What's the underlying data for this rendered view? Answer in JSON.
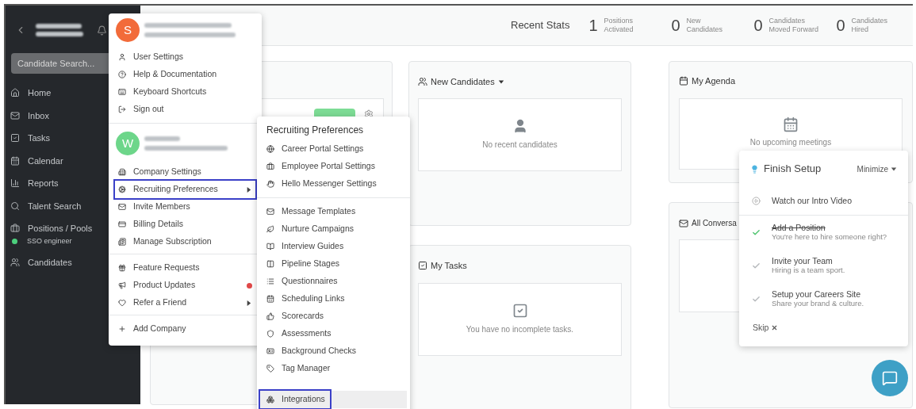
{
  "sidebar": {
    "search": {
      "placeholder": "Candidate Search..."
    },
    "items": [
      {
        "label": "Home"
      },
      {
        "label": "Inbox"
      },
      {
        "label": "Tasks"
      },
      {
        "label": "Calendar"
      },
      {
        "label": "Reports"
      },
      {
        "label": "Talent Search"
      },
      {
        "label": "Positions / Pools",
        "children": [
          {
            "label": "SSO engineer",
            "color": "#4cd07d"
          }
        ]
      },
      {
        "label": "Candidates"
      }
    ]
  },
  "header": {
    "title": "Recent Stats",
    "stats": [
      {
        "value": "1",
        "label": [
          "Positions",
          "Activated"
        ]
      },
      {
        "value": "0",
        "label": [
          "New",
          "Candidates"
        ]
      },
      {
        "value": "0",
        "label": [
          "Candidates",
          "Moved Forward"
        ]
      },
      {
        "value": "0",
        "label": [
          "Candidates",
          "Hired"
        ]
      }
    ]
  },
  "cards": {
    "new_candidates": {
      "title": "New Candidates",
      "empty_text": "No recent candidates"
    },
    "agenda": {
      "title": "My Agenda",
      "empty_text": "No upcoming meetings"
    },
    "tasks": {
      "title": "My Tasks",
      "empty_text": "You have no incomplete tasks."
    },
    "conversations": {
      "title": "All Conversa"
    }
  },
  "account_menu": {
    "user_avatar": {
      "letter": "S",
      "color": "#f26b3a"
    },
    "company_avatar": {
      "letter": "W",
      "color": "#6dd68a"
    },
    "groups": [
      [
        {
          "label": "User Settings",
          "submenu": false,
          "highlighted": false,
          "notification": false
        },
        {
          "label": "Help & Documentation",
          "submenu": false,
          "highlighted": false,
          "notification": false
        },
        {
          "label": "Keyboard Shortcuts",
          "submenu": false,
          "highlighted": false,
          "notification": false
        },
        {
          "label": "Sign out",
          "submenu": false,
          "highlighted": false,
          "notification": false
        }
      ],
      [
        {
          "label": "Company Settings",
          "submenu": false,
          "highlighted": false,
          "notification": false
        },
        {
          "label": "Recruiting Preferences",
          "submenu": true,
          "highlighted": true,
          "notification": false
        },
        {
          "label": "Invite Members",
          "submenu": false,
          "highlighted": false,
          "notification": false
        },
        {
          "label": "Billing Details",
          "submenu": false,
          "highlighted": false,
          "notification": false
        },
        {
          "label": "Manage Subscription",
          "submenu": false,
          "highlighted": false,
          "notification": false
        }
      ],
      [
        {
          "label": "Feature Requests",
          "submenu": false,
          "highlighted": false,
          "notification": false
        },
        {
          "label": "Product Updates",
          "submenu": false,
          "highlighted": false,
          "notification": true
        },
        {
          "label": "Refer a Friend",
          "submenu": true,
          "highlighted": false,
          "notification": false
        }
      ],
      [
        {
          "label": "Add Company",
          "submenu": false,
          "highlighted": false,
          "notification": false
        }
      ]
    ]
  },
  "submenu": {
    "title": "Recruiting Preferences",
    "groups": [
      [
        {
          "label": "Career Portal Settings",
          "highlighted": false,
          "hovered": false
        },
        {
          "label": "Employee Portal Settings",
          "highlighted": false,
          "hovered": false
        },
        {
          "label": "Hello Messenger Settings",
          "highlighted": false,
          "hovered": false
        }
      ],
      [
        {
          "label": "Message Templates",
          "highlighted": false,
          "hovered": false
        },
        {
          "label": "Nurture Campaigns",
          "highlighted": false,
          "hovered": false
        },
        {
          "label": "Interview Guides",
          "highlighted": false,
          "hovered": false
        },
        {
          "label": "Pipeline Stages",
          "highlighted": false,
          "hovered": false
        },
        {
          "label": "Questionnaires",
          "highlighted": false,
          "hovered": false
        },
        {
          "label": "Scheduling Links",
          "highlighted": false,
          "hovered": false
        },
        {
          "label": "Scorecards",
          "highlighted": false,
          "hovered": false
        },
        {
          "label": "Assessments",
          "highlighted": false,
          "hovered": false
        },
        {
          "label": "Background Checks",
          "highlighted": false,
          "hovered": false
        },
        {
          "label": "Tag Manager",
          "highlighted": false,
          "hovered": false
        }
      ],
      [
        {
          "label": "Integrations",
          "highlighted": true,
          "hovered": true
        }
      ]
    ]
  },
  "finish_setup": {
    "title": "Finish Setup",
    "minimize": "Minimize",
    "skip": "Skip",
    "steps": [
      {
        "kind": "video",
        "title": "Watch our Intro Video"
      },
      {
        "kind": "task",
        "title": "Add a Position",
        "subtitle": "You're here to hire someone right?",
        "done": true
      },
      {
        "kind": "task",
        "title": "Invite your Team",
        "subtitle": "Hiring is a team sport.",
        "done": false
      },
      {
        "kind": "task",
        "title": "Setup your Careers Site",
        "subtitle": "Share your brand & culture.",
        "done": false
      }
    ]
  }
}
